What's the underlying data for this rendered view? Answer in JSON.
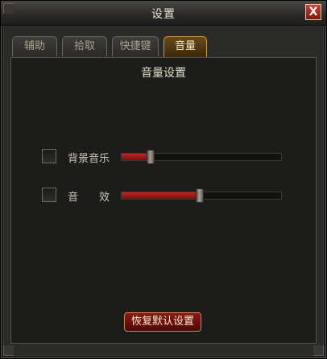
{
  "window": {
    "title": "设置",
    "close_label": "X"
  },
  "tabs": [
    {
      "label": "辅助",
      "active": false
    },
    {
      "label": "拾取",
      "active": false
    },
    {
      "label": "快捷键",
      "active": false
    },
    {
      "label": "音量",
      "active": true
    }
  ],
  "panel": {
    "title": "音量设置",
    "rows": [
      {
        "label": "背景音乐",
        "checked": false,
        "level_percent": 18
      },
      {
        "label": "音　　效",
        "checked": false,
        "level_percent": 49
      }
    ],
    "reset_label": "恢复默认设置"
  },
  "colors": {
    "accent": "#c42622",
    "active_tab": "#c99a3a",
    "close_button": "#b0301f"
  }
}
